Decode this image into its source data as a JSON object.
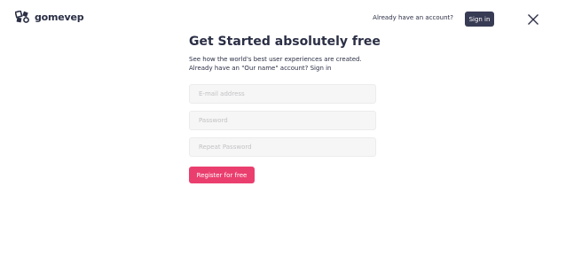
{
  "brand": {
    "name": "gomevep",
    "logo_icon": "puzzle-pieces-icon",
    "color": "#2b2f45"
  },
  "header": {
    "account_prompt": "Already have an account?",
    "sign_in_label": "Sign in",
    "sign_in_bg": "#383b54",
    "close_icon": "close-icon"
  },
  "form": {
    "title": "Get Started absolutely free",
    "subtitle": "See how the world's best user experiences are created. Already have an \"Our name\" account? Sign in",
    "email_placeholder": "E-mail address",
    "email_value": "",
    "password_placeholder": "Password",
    "password_value": "",
    "repeat_password_placeholder": "Repeat Password",
    "repeat_password_value": "",
    "submit_label": "Register for free",
    "submit_color": "#ea3f6e"
  }
}
